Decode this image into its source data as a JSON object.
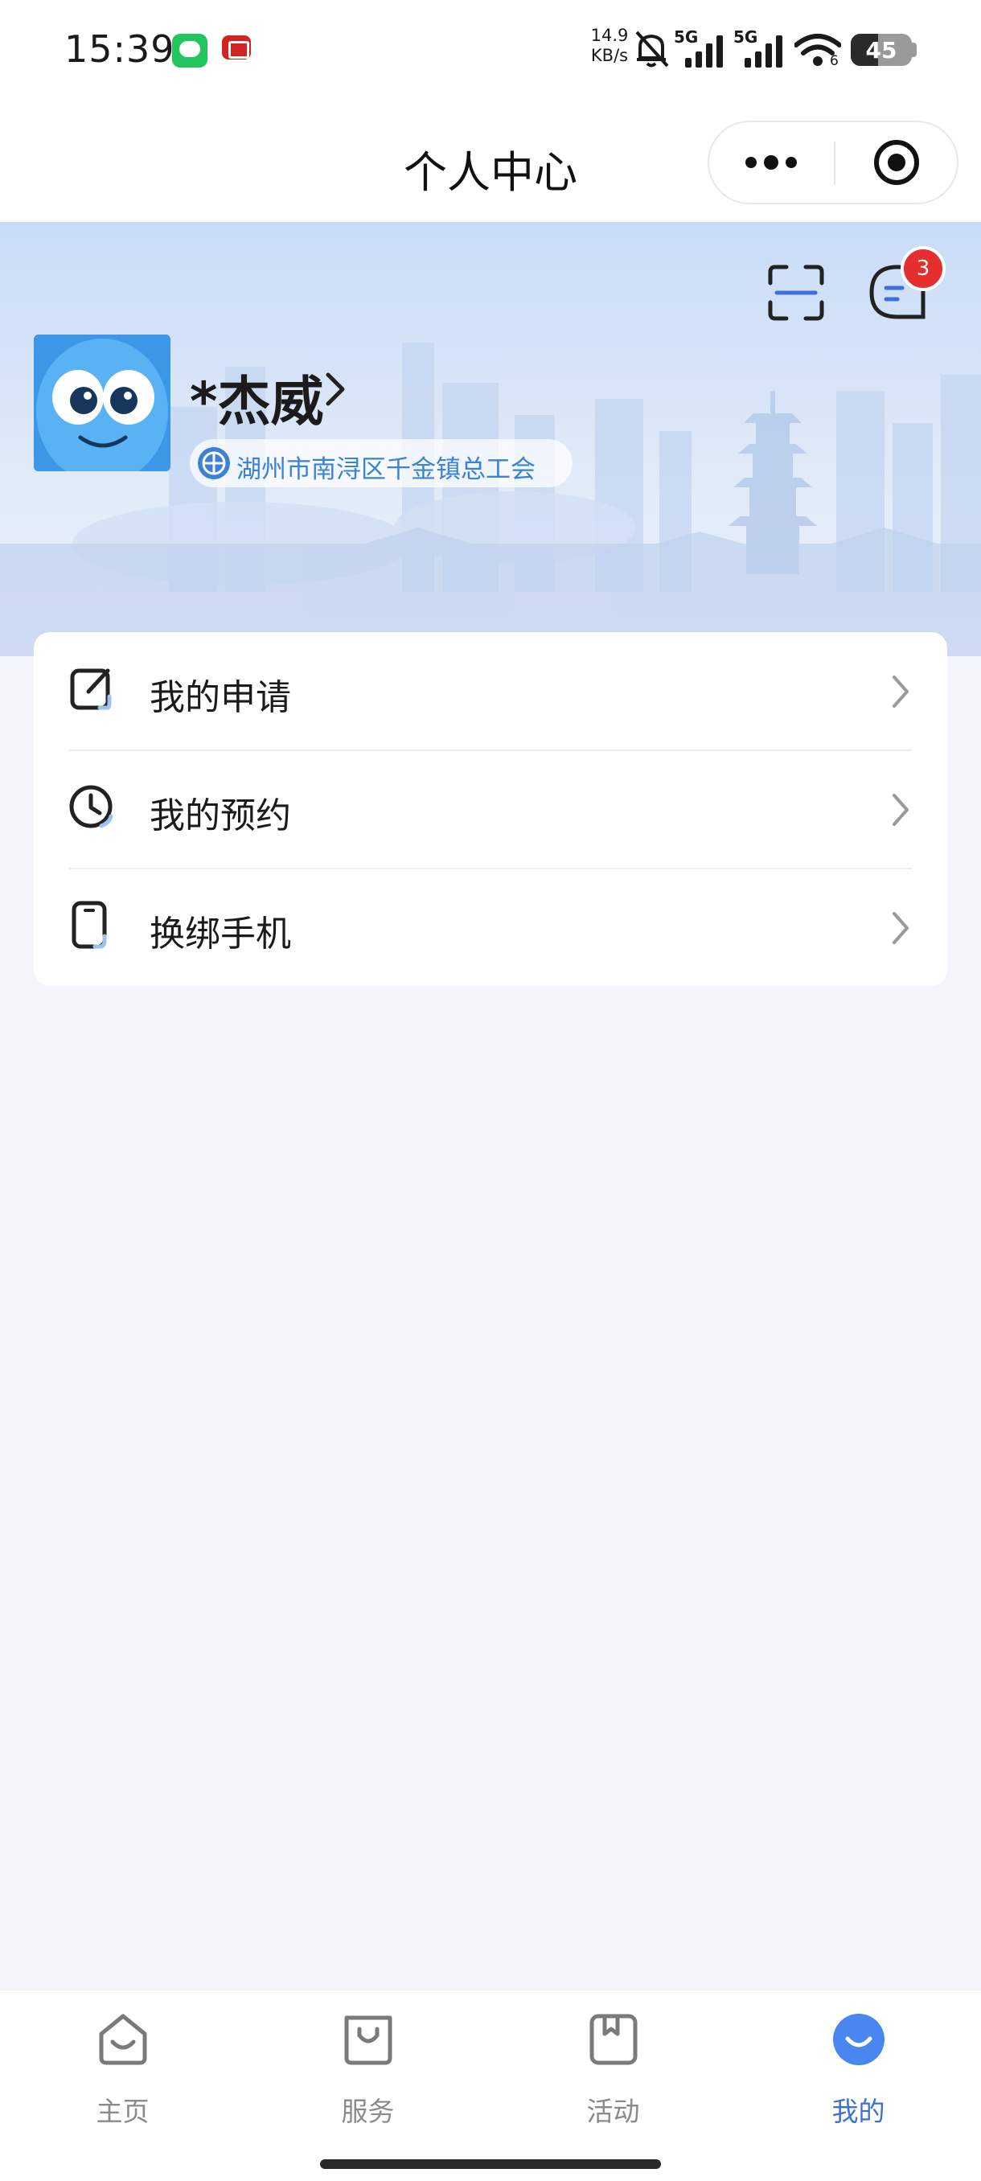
{
  "status_bar": {
    "time": "15:39",
    "net_speed_value": "14.9",
    "net_speed_unit": "KB/s",
    "signal_label_1": "5G",
    "signal_label_2": "5G",
    "wifi_sub": "6",
    "battery": "45"
  },
  "nav": {
    "title": "个人中心",
    "more_icon": "more-dots-icon",
    "close_icon": "target-close-icon"
  },
  "profile": {
    "name": "*杰威",
    "organization": "湖州市南浔区千金镇总工会",
    "message_badge": "3",
    "scan_icon": "scan-icon",
    "message_icon": "message-icon"
  },
  "menu": [
    {
      "label": "我的申请",
      "icon": "application-edit-icon"
    },
    {
      "label": "我的预约",
      "icon": "clock-icon"
    },
    {
      "label": "换绑手机",
      "icon": "phone-icon"
    }
  ],
  "tabs": [
    {
      "label": "主页",
      "icon": "home-icon",
      "active": false
    },
    {
      "label": "服务",
      "icon": "shopping-bag-icon",
      "active": false
    },
    {
      "label": "活动",
      "icon": "bookmark-icon",
      "active": false
    },
    {
      "label": "我的",
      "icon": "profile-smile-icon",
      "active": true
    }
  ],
  "colors": {
    "accent": "#3c6fd8",
    "badge": "#e52f2f",
    "org_text": "#3b82d6",
    "page_bg": "#f3f5fb"
  }
}
